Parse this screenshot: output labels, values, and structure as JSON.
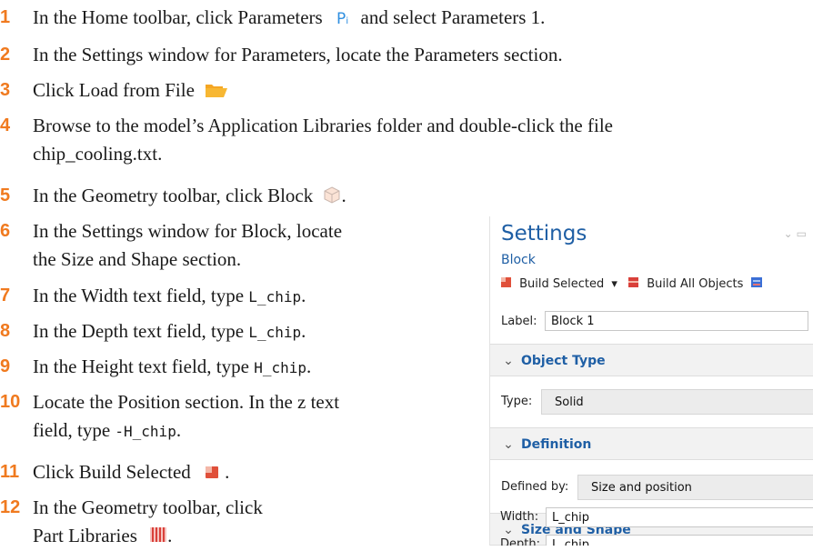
{
  "steps": [
    {
      "num": "1",
      "text": "In the Home toolbar, click Parameters",
      "icon": "parameters-icon",
      "icon_glyph": "Pᵢ",
      "text2": "and select Parameters 1."
    },
    {
      "num": "2",
      "text": "In the Settings window for Parameters, locate the Parameters section."
    },
    {
      "num": "3",
      "text": "Click Load from File",
      "icon": "folder-open-icon"
    },
    {
      "num": "4",
      "text": "Browse to the model’s Application Libraries folder and double-click the file",
      "text_line2": "chip_cooling.txt."
    },
    {
      "num": "5",
      "text": "In the Geometry toolbar, click Block",
      "icon": "block-icon",
      "text2": "."
    },
    {
      "num": "6",
      "text": "In the Settings window for Block, locate",
      "text_line2": "the Size and Shape section."
    },
    {
      "num": "7",
      "text": "In the Width text field, type",
      "code": "L_chip",
      "text2": "."
    },
    {
      "num": "8",
      "text": "In the Depth text field, type",
      "code": "L_chip",
      "text2": "."
    },
    {
      "num": "9",
      "text": "In the Height text field, type",
      "code": "H_chip",
      "text2": "."
    },
    {
      "num": "10",
      "text": "Locate the Position section. In the z text",
      "text_line2_prefix": "field, type",
      "code": "-H_chip",
      "text2": "."
    },
    {
      "num": "11",
      "text": "Click Build Selected",
      "icon": "build-selected-icon",
      "text2": "."
    },
    {
      "num": "12",
      "text": "In the Geometry toolbar, click",
      "text_line2": "Part Libraries",
      "icon": "part-libraries-icon",
      "text2": "."
    }
  ],
  "settings_panel": {
    "title": "Settings",
    "subtitle": "Block",
    "toolbar": {
      "build_selected": "Build Selected",
      "build_all": "Build All Objects"
    },
    "label_caption": "Label:",
    "label_value": "Block 1",
    "sections": {
      "object_type": "Object Type",
      "definition": "Definition",
      "size_and_shape": "Size and Shape"
    },
    "type_caption": "Type:",
    "type_value": "Solid",
    "defined_by_caption": "Defined by:",
    "defined_by_value": "Size and position",
    "width_caption": "Width:",
    "width_value": "L_chip",
    "depth_caption": "Depth:",
    "depth_value": "L_chip"
  },
  "colors": {
    "step_number": "#f07a1f",
    "heading_blue": "#1f5fa5"
  }
}
